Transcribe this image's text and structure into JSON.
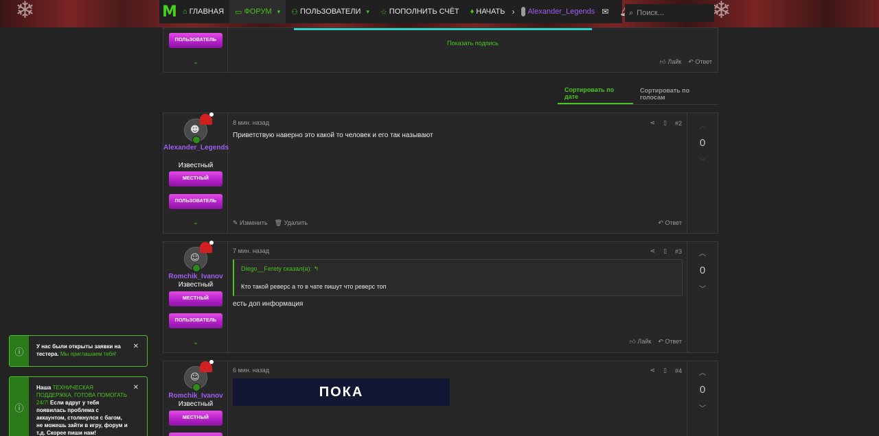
{
  "nav": {
    "logo": "M",
    "items": [
      {
        "label": "ГЛАВНАЯ",
        "icon": "home-icon"
      },
      {
        "label": "ФОРУМ",
        "icon": "forum-icon"
      },
      {
        "label": "ПОЛЬЗОВАТЕЛИ",
        "icon": "users-icon"
      },
      {
        "label": "ПОПОЛНИТЬ СЧЁТ",
        "icon": "star-icon"
      },
      {
        "label": "НАЧАТЬ",
        "icon": "flame-icon"
      }
    ],
    "username": "Alexander_Legends",
    "search_placeholder": "Поиск..."
  },
  "prev_post": {
    "badge": "ПОЛЬЗОВАТЕЛЬ",
    "show_signature": "Показать подпись",
    "like": "Лайк",
    "reply": "Ответ"
  },
  "sort": {
    "by_date": "Сортировать по дате",
    "by_votes": "Сортировать по голосам"
  },
  "posts": [
    {
      "time": "8 мин. назад",
      "number": "#2",
      "username": "Alexander_Legends",
      "user_title": "Известный",
      "badges": [
        "МЕСТНЫЙ",
        "ПОЛЬЗОВАТЕЛЬ"
      ],
      "text": "Приветствую наверно это какой то человек и его так называют",
      "edit": "Изменить",
      "delete": "Удалить",
      "reply": "Ответ",
      "score": "0"
    },
    {
      "time": "7 мин. назад",
      "number": "#3",
      "username": "Romchik_Ivanov",
      "user_title": "Известный",
      "badges": [
        "МЕСТНЫЙ",
        "ПОЛЬЗОВАТЕЛЬ"
      ],
      "quote_author": "Diego__Ferety сказал(а):",
      "quote_text": "Кто такой реверс а то в чате пишут что реверс топ",
      "text": "есть доп информация",
      "like": "Лайк",
      "reply": "Ответ",
      "score": "0"
    },
    {
      "time": "6 мин. назад",
      "number": "#4",
      "username": "Romchik_Ivanov",
      "user_title": "Известный",
      "badges": [
        "МЕСТНЫЙ"
      ],
      "image_text": "ПОКА",
      "score": "0"
    }
  ],
  "toasts": [
    {
      "text": "У нас были открыты заявки на тестера.",
      "link": "Мы приглашаем тебя!"
    },
    {
      "prefix": "Наша",
      "link": "ТЕХНИЧЕСКАЯ ПОДДЕРЖКА, ГОТОВА ПОМОГАТЬ 24/7!",
      "text": "Если вдруг у тебя появилась проблема с аккаунтом, столкнулся с багом, не можешь зайти в игру, форум и т.д. Скорее пиши нам!"
    }
  ],
  "colors": {
    "accent": "#49c51c",
    "username": "#a05ef0",
    "badge": "#c52bd6"
  }
}
